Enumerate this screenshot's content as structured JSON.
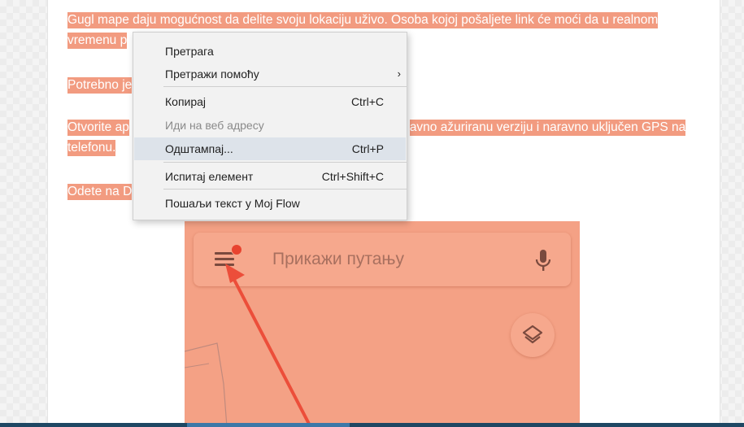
{
  "article": {
    "p1": "Gugl mape daju mogućnost da delite svoju lokaciju uživo. Osoba kojoj pošaljete link će moći da u realnom vremenu p",
    "p2": "Potrebno je",
    "p3": "Otvorite ap                                                  avno ažuriranu verziju i naravno uključen GPS na telefonu.",
    "p3a": "Otvorite ap",
    "p3b": "avno ažuriranu verziju i naravno uključen GPS na telefonu.",
    "p4": "Odete na D"
  },
  "screenshot": {
    "search_placeholder": "Прикажи путању",
    "icons": [
      "menu-icon",
      "notification-dot",
      "mic-icon",
      "layers-icon",
      "red-arrow"
    ]
  },
  "context_menu": {
    "items": [
      {
        "label": "Претрага",
        "shortcut": "",
        "submenu": false,
        "disabled": false,
        "hover": false
      },
      {
        "label": "Претражи помоћу",
        "shortcut": "",
        "submenu": true,
        "disabled": false,
        "hover": false
      },
      {
        "label": "Копирај",
        "shortcut": "Ctrl+C",
        "submenu": false,
        "disabled": false,
        "hover": false
      },
      {
        "label": "Иди на веб адресу",
        "shortcut": "",
        "submenu": false,
        "disabled": true,
        "hover": false
      },
      {
        "label": "Одштампај...",
        "shortcut": "Ctrl+P",
        "submenu": false,
        "disabled": false,
        "hover": true
      },
      {
        "label": "Испитај елемент",
        "shortcut": "Ctrl+Shift+C",
        "submenu": false,
        "disabled": false,
        "hover": false
      },
      {
        "label": "Пошаљи текст у Moj Flow",
        "shortcut": "",
        "submenu": false,
        "disabled": false,
        "hover": false
      }
    ],
    "submenu_glyph": "›"
  },
  "colors": {
    "selection": "#f29b80",
    "image_bg": "#f4a185",
    "arrow": "#ec4e3a",
    "menu_bg": "#f2f2f2",
    "menu_hover": "#dde3ea",
    "taskbar": "#1e4763"
  }
}
